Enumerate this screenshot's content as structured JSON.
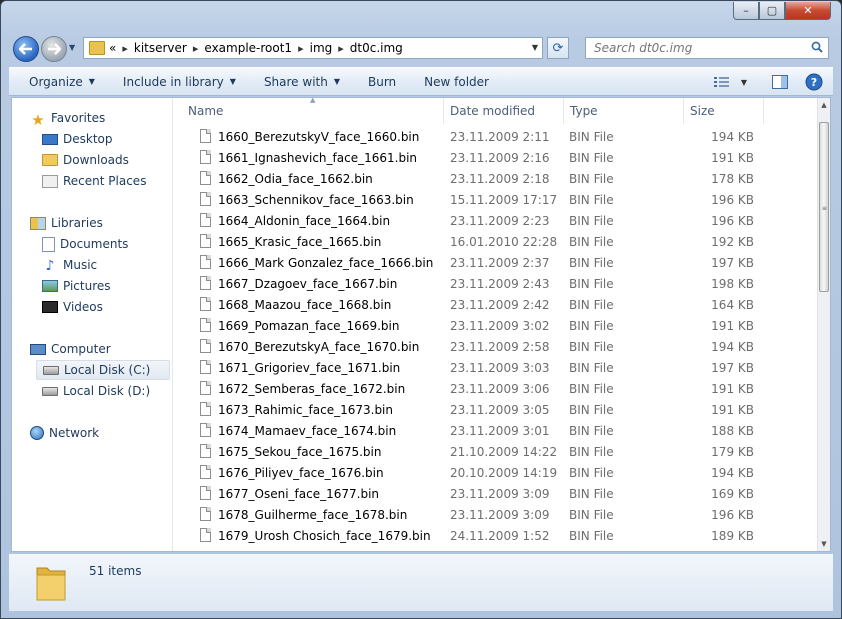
{
  "window": {
    "caption": {
      "minimize": "–",
      "maximize": "▢",
      "close": "✕"
    }
  },
  "address": {
    "breadcrumbs": [
      "kitserver",
      "example-root1",
      "img",
      "dt0c.img"
    ],
    "overflow_chevron": "«"
  },
  "search": {
    "placeholder": "Search dt0c.img"
  },
  "toolbar": {
    "organize": "Organize",
    "include_in_library": "Include in library",
    "share_with": "Share with",
    "burn": "Burn",
    "new_folder": "New folder"
  },
  "nav": {
    "favorites": {
      "label": "Favorites",
      "icon": "star-icon",
      "items": [
        {
          "label": "Desktop",
          "icon": "desktop-icon"
        },
        {
          "label": "Downloads",
          "icon": "downloads-folder-icon"
        },
        {
          "label": "Recent Places",
          "icon": "recent-places-icon"
        }
      ]
    },
    "libraries": {
      "label": "Libraries",
      "icon": "libraries-icon",
      "items": [
        {
          "label": "Documents",
          "icon": "documents-icon"
        },
        {
          "label": "Music",
          "icon": "music-icon"
        },
        {
          "label": "Pictures",
          "icon": "pictures-icon"
        },
        {
          "label": "Videos",
          "icon": "videos-icon"
        }
      ]
    },
    "computer": {
      "label": "Computer",
      "icon": "computer-icon",
      "items": [
        {
          "label": "Local Disk (C:)",
          "icon": "system-disk-icon",
          "selected": true
        },
        {
          "label": "Local Disk (D:)",
          "icon": "disk-icon"
        }
      ]
    },
    "network": {
      "label": "Network",
      "icon": "network-icon"
    }
  },
  "columns": {
    "name": "Name",
    "date_modified": "Date modified",
    "type": "Type",
    "size": "Size"
  },
  "files": [
    {
      "name": "1660_BerezutskyV_face_1660.bin",
      "date": "23.11.2009 2:11",
      "type": "BIN File",
      "size": "194 KB"
    },
    {
      "name": "1661_Ignashevich_face_1661.bin",
      "date": "23.11.2009 2:16",
      "type": "BIN File",
      "size": "191 KB"
    },
    {
      "name": "1662_Odia_face_1662.bin",
      "date": "23.11.2009 2:18",
      "type": "BIN File",
      "size": "178 KB"
    },
    {
      "name": "1663_Schennikov_face_1663.bin",
      "date": "15.11.2009 17:17",
      "type": "BIN File",
      "size": "196 KB"
    },
    {
      "name": "1664_Aldonin_face_1664.bin",
      "date": "23.11.2009 2:23",
      "type": "BIN File",
      "size": "196 KB"
    },
    {
      "name": "1665_Krasic_face_1665.bin",
      "date": "16.01.2010 22:28",
      "type": "BIN File",
      "size": "192 KB"
    },
    {
      "name": "1666_Mark Gonzalez_face_1666.bin",
      "date": "23.11.2009 2:37",
      "type": "BIN File",
      "size": "197 KB"
    },
    {
      "name": "1667_Dzagoev_face_1667.bin",
      "date": "23.11.2009 2:43",
      "type": "BIN File",
      "size": "198 KB"
    },
    {
      "name": "1668_Maazou_face_1668.bin",
      "date": "23.11.2009 2:42",
      "type": "BIN File",
      "size": "164 KB"
    },
    {
      "name": "1669_Pomazan_face_1669.bin",
      "date": "23.11.2009 3:02",
      "type": "BIN File",
      "size": "191 KB"
    },
    {
      "name": "1670_BerezutskyA_face_1670.bin",
      "date": "23.11.2009 2:58",
      "type": "BIN File",
      "size": "194 KB"
    },
    {
      "name": "1671_Grigoriev_face_1671.bin",
      "date": "23.11.2009 3:03",
      "type": "BIN File",
      "size": "197 KB"
    },
    {
      "name": "1672_Semberas_face_1672.bin",
      "date": "23.11.2009 3:06",
      "type": "BIN File",
      "size": "191 KB"
    },
    {
      "name": "1673_Rahimic_face_1673.bin",
      "date": "23.11.2009 3:05",
      "type": "BIN File",
      "size": "191 KB"
    },
    {
      "name": "1674_Mamaev_face_1674.bin",
      "date": "23.11.2009 3:01",
      "type": "BIN File",
      "size": "188 KB"
    },
    {
      "name": "1675_Sekou_face_1675.bin",
      "date": "21.10.2009 14:22",
      "type": "BIN File",
      "size": "179 KB"
    },
    {
      "name": "1676_Piliyev_face_1676.bin",
      "date": "20.10.2009 14:19",
      "type": "BIN File",
      "size": "194 KB"
    },
    {
      "name": "1677_Oseni_face_1677.bin",
      "date": "23.11.2009 3:09",
      "type": "BIN File",
      "size": "169 KB"
    },
    {
      "name": "1678_Guilherme_face_1678.bin",
      "date": "23.11.2009 3:09",
      "type": "BIN File",
      "size": "196 KB"
    },
    {
      "name": "1679_Urosh Chosich_face_1679.bin",
      "date": "24.11.2009 1:52",
      "type": "BIN File",
      "size": "189 KB"
    }
  ],
  "status": {
    "item_count": "51 items"
  }
}
